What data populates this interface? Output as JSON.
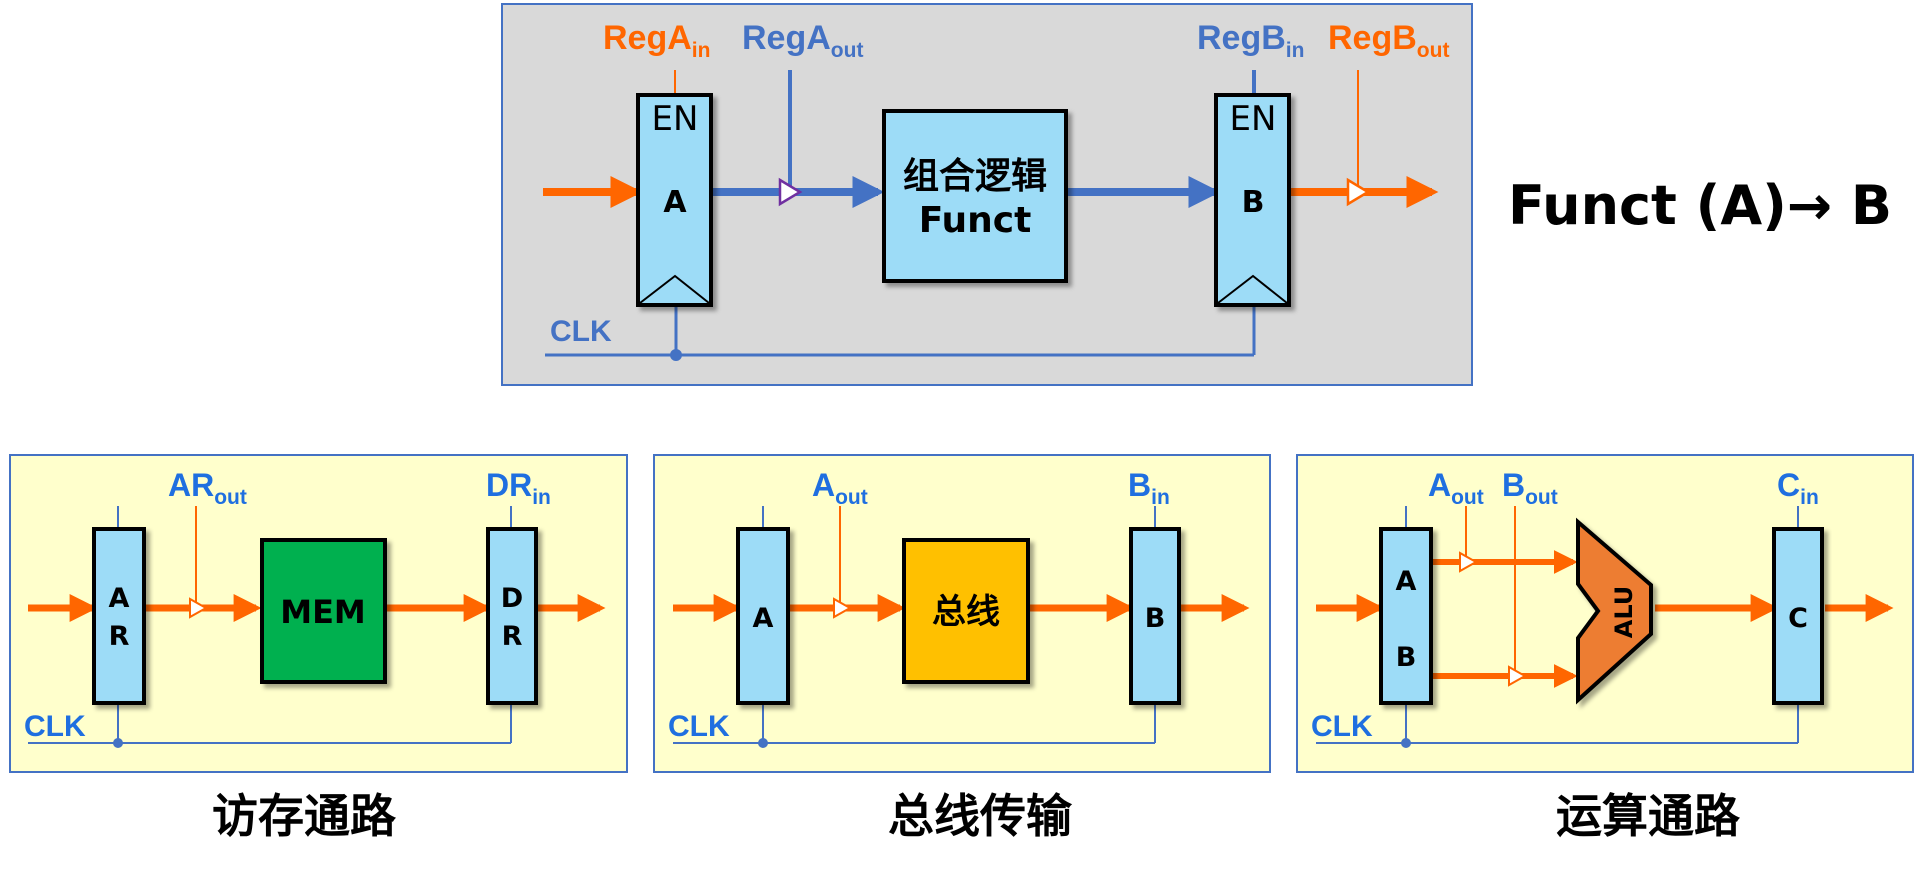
{
  "top": {
    "signals": {
      "rega_in_base": "RegA",
      "rega_in_sub": "in",
      "rega_out_base": "RegA",
      "rega_out_sub": "out",
      "regb_in_base": "RegB",
      "regb_in_sub": "in",
      "regb_out_base": "RegB",
      "regb_out_sub": "out"
    },
    "reg_a": {
      "en": "EN",
      "name": "A"
    },
    "reg_b": {
      "en": "EN",
      "name": "B"
    },
    "logic": {
      "line1": "组合逻辑",
      "line2": "Funct"
    },
    "clk": "CLK",
    "formula": "Funct (A)→ B"
  },
  "panels": {
    "mem": {
      "ar_out_base": "AR",
      "ar_out_sub": "out",
      "dr_in_base": "DR",
      "dr_in_sub": "in",
      "reg1_top": "A",
      "reg1_bottom": "R",
      "block": "MEM",
      "reg2_top": "D",
      "reg2_bottom": "R",
      "clk": "CLK",
      "caption": "访存通路"
    },
    "bus": {
      "a_out_base": "A",
      "a_out_sub": "out",
      "b_in_base": "B",
      "b_in_sub": "in",
      "reg1": "A",
      "block": "总线",
      "reg2": "B",
      "clk": "CLK",
      "caption": "总线传输"
    },
    "alu": {
      "a_out_base": "A",
      "a_out_sub": "out",
      "b_out_base": "B",
      "b_out_sub": "out",
      "c_in_base": "C",
      "c_in_sub": "in",
      "reg1_top": "A",
      "reg1_bottom": "B",
      "block": "ALU",
      "reg2": "C",
      "clk": "CLK",
      "caption": "运算通路"
    }
  },
  "colors": {
    "orange": "#FF6600",
    "blue": "#4472C4",
    "label_blue": "#1F6FE0",
    "reg_fill": "#9DDCF7",
    "top_bg": "#D9D9D9",
    "panel_bg": "#FFFFCC",
    "mem_fill": "#00B050",
    "bus_fill": "#FFC000",
    "alu_fill": "#ED7D31"
  }
}
